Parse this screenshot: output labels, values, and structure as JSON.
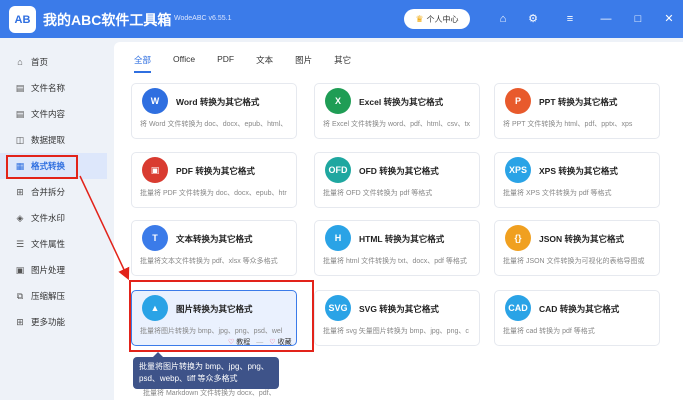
{
  "app": {
    "logo_text": "AB",
    "title": "我的ABC软件工具箱",
    "version": "WodeABC v6.55.1",
    "user_center": "个人中心"
  },
  "colors": {
    "accent": "#3b7be9",
    "highlight_red": "#e2231a",
    "tooltip_bg": "#3e5389"
  },
  "sidebar": {
    "items": [
      {
        "label": "首页",
        "icon": "home-icon",
        "glyph": "⌂"
      },
      {
        "label": "文件名称",
        "icon": "file-name-icon",
        "glyph": "▤"
      },
      {
        "label": "文件内容",
        "icon": "file-content-icon",
        "glyph": "▤"
      },
      {
        "label": "数据提取",
        "icon": "data-extract-icon",
        "glyph": "◫"
      },
      {
        "label": "格式转换",
        "icon": "format-convert-icon",
        "glyph": "▦"
      },
      {
        "label": "合并拆分",
        "icon": "merge-split-icon",
        "glyph": "⊞"
      },
      {
        "label": "文件水印",
        "icon": "watermark-icon",
        "glyph": "◈"
      },
      {
        "label": "文件属性",
        "icon": "file-attr-icon",
        "glyph": "☰"
      },
      {
        "label": "图片处理",
        "icon": "image-process-icon",
        "glyph": "▣"
      },
      {
        "label": "压缩解压",
        "icon": "compress-icon",
        "glyph": "⧉"
      },
      {
        "label": "更多功能",
        "icon": "more-icon",
        "glyph": "⊞"
      }
    ]
  },
  "tabs": [
    "全部",
    "Office",
    "PDF",
    "文本",
    "图片",
    "其它"
  ],
  "cards": [
    {
      "title": "Word 转换为其它格式",
      "desc": "将 Word 文件转换为 doc、docx、epub、html、",
      "icon_text": "W",
      "color": "#2f6fe0"
    },
    {
      "title": "Excel 转换为其它格式",
      "desc": "将 Excel 文件转换为 word、pdf、html、csv、tx",
      "icon_text": "X",
      "color": "#1f9d55"
    },
    {
      "title": "PPT 转换为其它格式",
      "desc": "将 PPT 文件转换为 html、pdf、pptx、xps",
      "icon_text": "P",
      "color": "#e85a2c"
    },
    {
      "title": "PDF 转换为其它格式",
      "desc": "批量将 PDF 文件转换为 doc、docx、epub、htr",
      "icon_text": "▣",
      "color": "#d93b30"
    },
    {
      "title": "OFD 转换为其它格式",
      "desc": "批量将 OFD 文件转换为 pdf 等格式",
      "icon_text": "OFD",
      "color": "#1fa7a0"
    },
    {
      "title": "XPS 转换为其它格式",
      "desc": "批量将 XPS 文件转换为 pdf 等格式",
      "icon_text": "XPS",
      "color": "#2aa3e6"
    },
    {
      "title": "文本转换为其它格式",
      "desc": "批量将文本文件转换为 pdf、xlsx 等众多格式",
      "icon_text": "T",
      "color": "#3b7be9"
    },
    {
      "title": "HTML 转换为其它格式",
      "desc": "批量将 html 文件转换为 txt、docx、pdf 等格式",
      "icon_text": "H",
      "color": "#2aa3e6"
    },
    {
      "title": "JSON 转换为其它格式",
      "desc": "批量将 JSON 文件转换为可视化的表格导图或",
      "icon_text": "{}",
      "color": "#f0a020"
    },
    {
      "title": "图片转换为其它格式",
      "desc": "批量将图片转换为 bmp、jpg、png、psd、wel",
      "icon_text": "▲",
      "color": "#2aa3e6"
    },
    {
      "title": "SVG 转换为其它格式",
      "desc": "批量将 svg 矢量图片转换为 bmp、jpg、png、c",
      "icon_text": "SVG",
      "color": "#2aa3e6"
    },
    {
      "title": "CAD 转换为其它格式",
      "desc": "批量将 cad 转换为 pdf 等格式",
      "icon_text": "CAD",
      "color": "#2aa3e6"
    }
  ],
  "card_actions": {
    "tutorial": "教程",
    "favorite": "收藏"
  },
  "tooltip": {
    "line1": "批量将图片转换为 bmp、jpg、png、",
    "line2": "psd、webp、tiff 等众多格式"
  },
  "bottom_desc": "批量将 Markdown 文件转换为 docx、pdf、"
}
